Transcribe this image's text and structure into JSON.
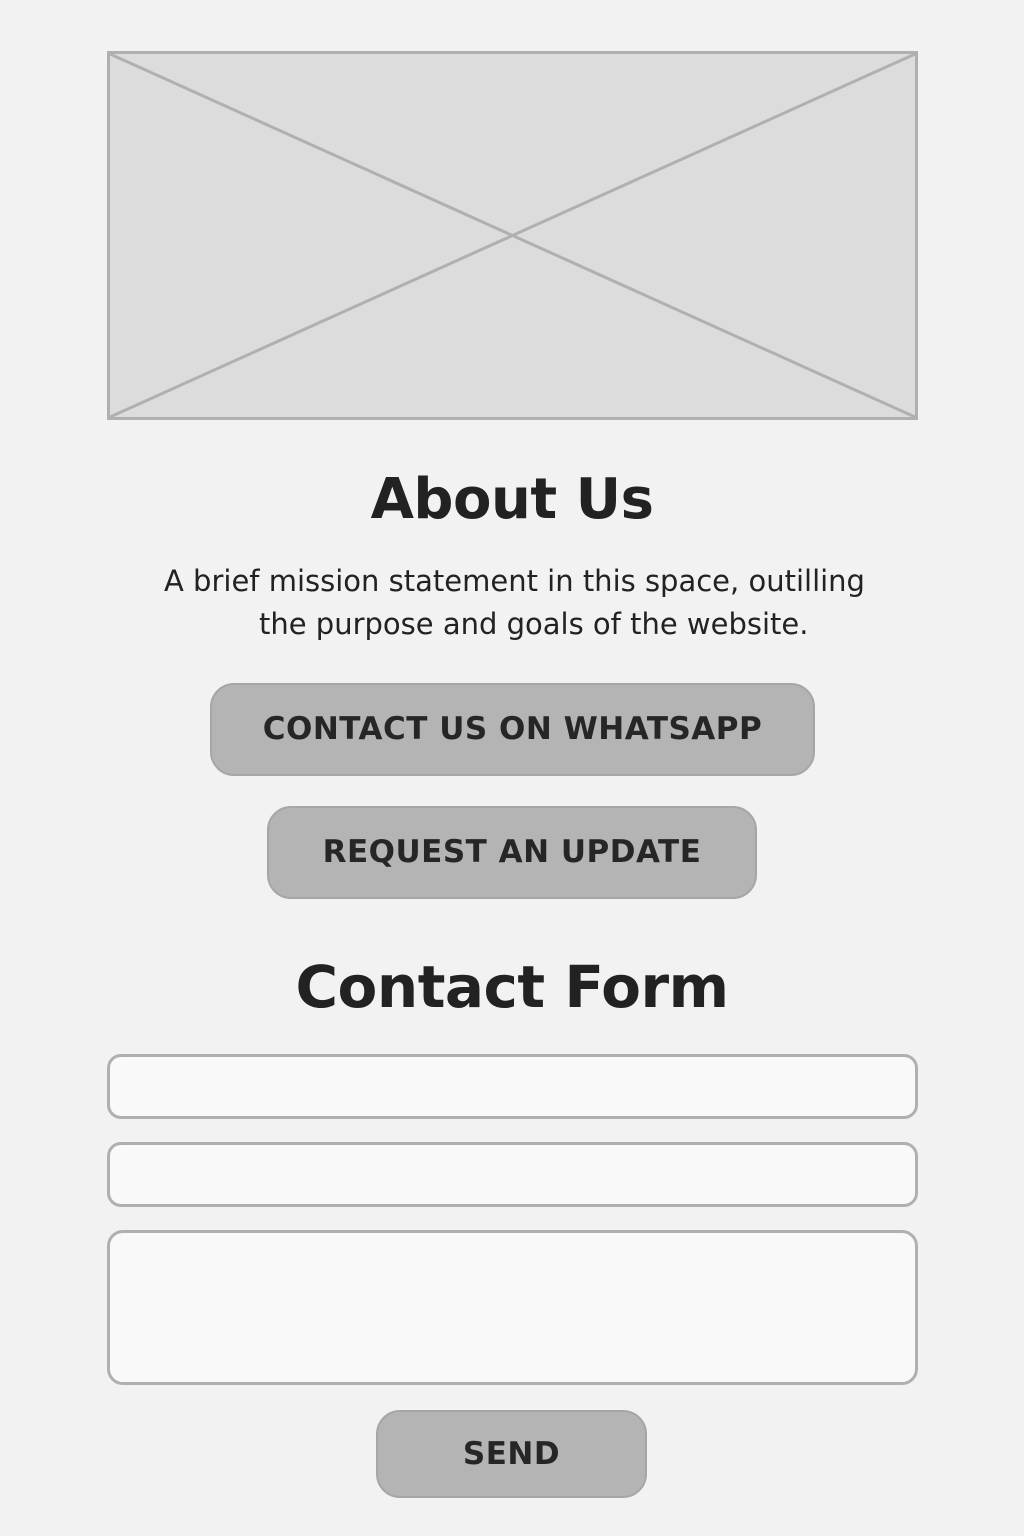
{
  "hero": {
    "icon": "image-placeholder-icon"
  },
  "about": {
    "title": "About Us",
    "mission_line1": "A brief mission statement in this space, outilling",
    "mission_line2": "the purpose and goals of the website."
  },
  "actions": {
    "whatsapp_label": "CONTACT US ON WHATSAPP",
    "update_label": "REQUEST AN UPDATE"
  },
  "contact_form": {
    "title": "Contact Form",
    "field_1_value": "",
    "field_2_value": "",
    "message_value": "",
    "send_label": "SEND"
  },
  "colors": {
    "background": "#f2f2f2",
    "placeholder_fill": "#dcdcdc",
    "border": "#b0b0b0",
    "button_fill": "#b4b4b4",
    "text": "#222222"
  }
}
